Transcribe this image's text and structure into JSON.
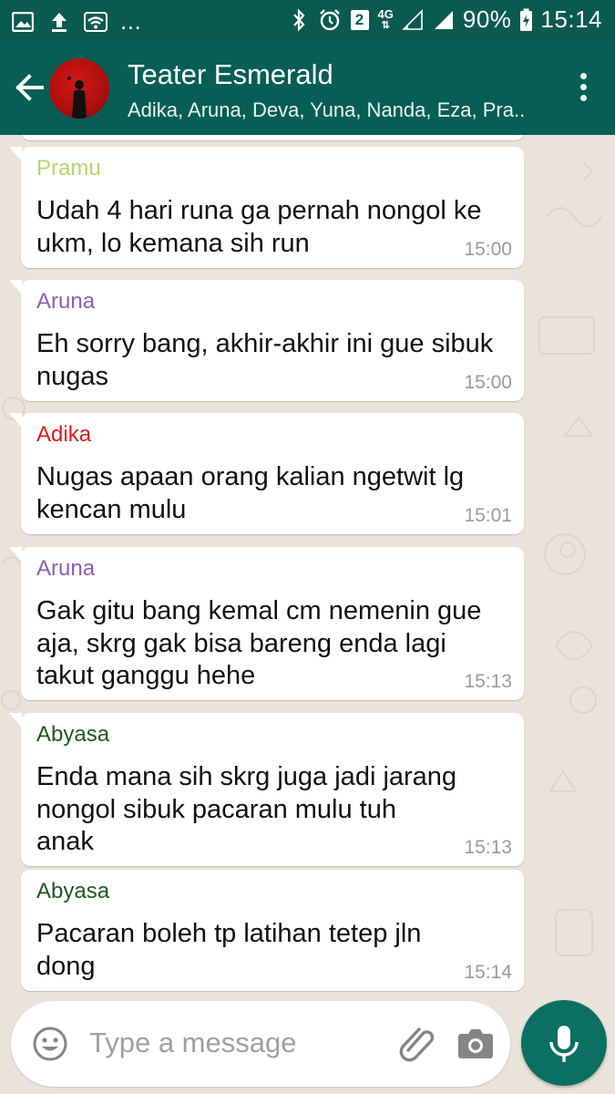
{
  "status_bar": {
    "left_icons": [
      "image-icon",
      "upload-icon",
      "wifi-icon",
      "more-notifications-icon"
    ],
    "more": "...",
    "right_icons": [
      "bluetooth-icon",
      "alarm-icon",
      "sim2-icon",
      "network-4g-icon",
      "signal-icon",
      "battery-icon"
    ],
    "sim": "2",
    "network": "4G",
    "battery": "90%",
    "time": "15:14"
  },
  "header": {
    "title": "Teater Esmerald",
    "members": "Adika, Aruna, Deva, Yuna, Nanda, Eza, Pra.."
  },
  "messages": [
    {
      "sender": "Pramu",
      "sender_color": "#b5d66a",
      "lines": [
        "Udah 4 hari runa ga pernah nongol ke",
        "ukm, lo kemana sih run"
      ],
      "time": "15:00"
    },
    {
      "sender": "Aruna",
      "sender_color": "#8e5fb3",
      "lines": [
        "Eh sorry bang, akhir-akhir ini gue sibuk",
        "nugas"
      ],
      "time": "15:00"
    },
    {
      "sender": "Adika",
      "sender_color": "#e0191f",
      "lines": [
        "Nugas apaan orang kalian ngetwit lg",
        "kencan mulu"
      ],
      "time": "15:01"
    },
    {
      "sender": "Aruna",
      "sender_color": "#8e5fb3",
      "lines": [
        "Gak gitu bang kemal cm nemenin gue",
        "aja, skrg gak bisa bareng enda lagi",
        "takut ganggu hehe"
      ],
      "time": "15:13"
    },
    {
      "sender": "Abyasa",
      "sender_color": "#1e5a1e",
      "lines": [
        "Enda mana sih skrg juga jadi jarang",
        "nongol sibuk pacaran mulu tuh",
        "anak"
      ],
      "time": "15:13"
    },
    {
      "sender": "Abyasa",
      "sender_color": "#1e5a1e",
      "lines": [
        "Pacaran boleh tp latihan tetep jln",
        "dong"
      ],
      "time": "15:14"
    }
  ],
  "composer": {
    "placeholder": "Type a message"
  },
  "colors": {
    "header": "#075e54",
    "status_bar": "#0b5a50",
    "mic_button": "#0b6f62",
    "chat_background": "#e9e3da"
  }
}
